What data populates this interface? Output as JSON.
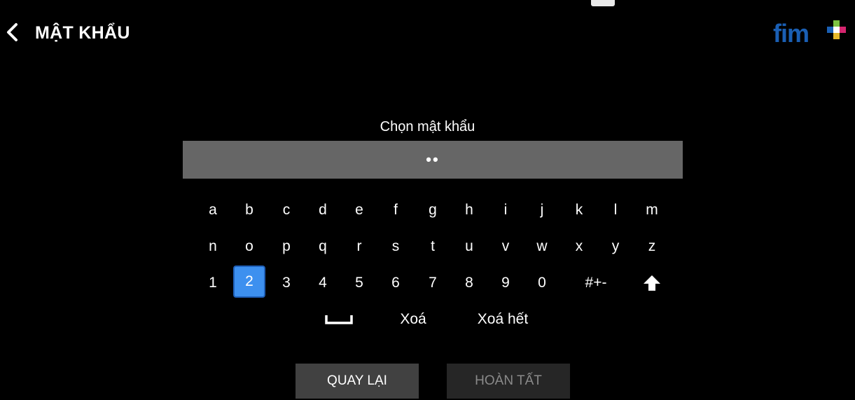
{
  "header": {
    "title": "MẬT KHẨU",
    "back_icon": "chevron-left-icon",
    "logo_text": "fim+"
  },
  "prompt": "Chọn mật khẩu",
  "password_field": {
    "value": "••"
  },
  "keyboard": {
    "row1": [
      "a",
      "b",
      "c",
      "d",
      "e",
      "f",
      "g",
      "h",
      "i",
      "j",
      "k",
      "l",
      "m"
    ],
    "row2": [
      "n",
      "o",
      "p",
      "q",
      "r",
      "s",
      "t",
      "u",
      "v",
      "w",
      "x",
      "y",
      "z"
    ],
    "row3": [
      "1",
      "2",
      "3",
      "4",
      "5",
      "6",
      "7",
      "8",
      "9",
      "0"
    ],
    "symbols_label": "#+-",
    "shift_icon": "shift-arrow-icon",
    "space_icon": "space-bar-icon",
    "delete_label": "Xoá",
    "clear_label": "Xoá hết",
    "selected_key": "2"
  },
  "buttons": {
    "back": "QUAY LẠI",
    "done": "HOÀN TẤT"
  },
  "colors": {
    "background": "#000000",
    "field": "#666666",
    "selected_key": "#3d90ef",
    "logo_blue": "#1a5fb4",
    "logo_green": "#7cc242",
    "logo_magenta": "#d5256f"
  }
}
